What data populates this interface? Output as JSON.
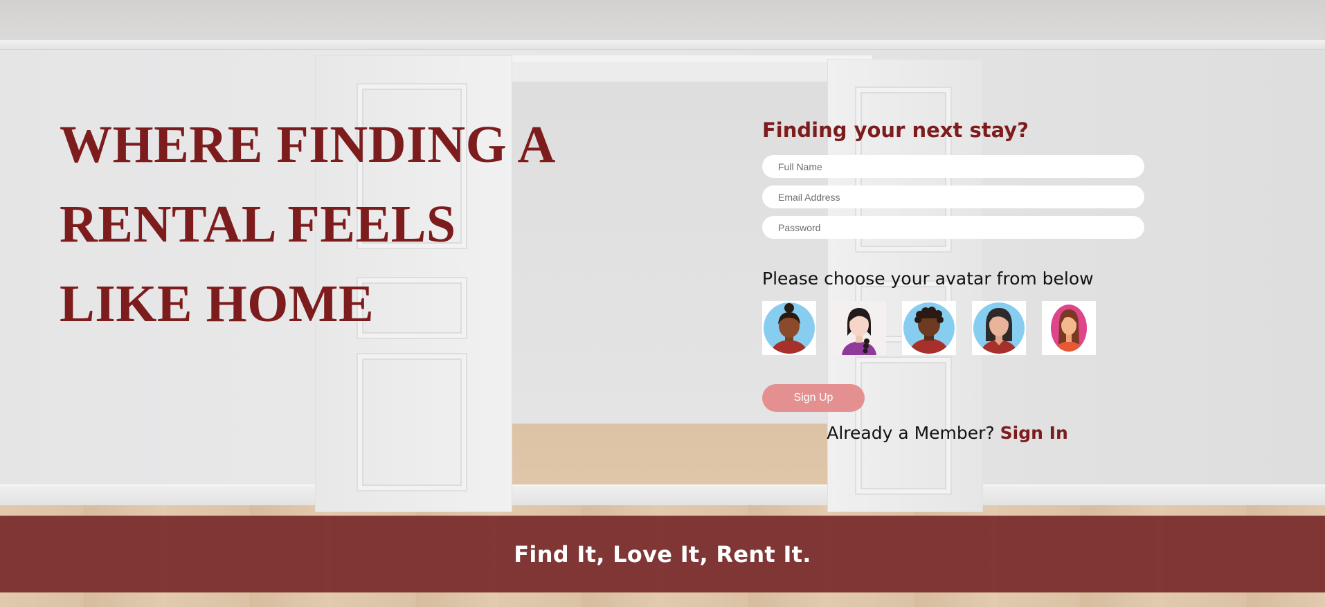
{
  "headline": {
    "lines": [
      "WHERE FINDING A",
      "RENTAL FEELS",
      "LIKE HOME"
    ]
  },
  "form": {
    "title": "Finding your next stay?",
    "full_name_placeholder": "Full Name",
    "email_placeholder": "Email Address",
    "password_placeholder": "Password",
    "avatar_heading": "Please choose your avatar from below",
    "avatars": [
      {
        "icon": "avatar-woman-bun-icon",
        "bg": "#87cdf0",
        "skin": "#8b4a2b",
        "hair": "#2a1a14",
        "shirt": "#a8302a"
      },
      {
        "icon": "avatar-woman-braid-icon",
        "bg": "#f3f0ef",
        "skin": "#f6d6c8",
        "hair": "#231a1c",
        "shirt": "#8e3a9a"
      },
      {
        "icon": "avatar-man-curly-icon",
        "bg": "#87cdf0",
        "skin": "#6e3a22",
        "hair": "#2a1a14",
        "shirt": "#a8302a"
      },
      {
        "icon": "avatar-woman-straight-icon",
        "bg": "#87cdf0",
        "skin": "#e8b49a",
        "hair": "#2f2a2a",
        "shirt": "#a8302a"
      },
      {
        "icon": "avatar-woman-long-hair-icon",
        "bg": "#e0448a",
        "skin": "#f6b88e",
        "hair": "#7a3a22",
        "shirt": "#e55a35"
      }
    ],
    "signup_label": "Sign Up",
    "member_prompt": "Already a Member?",
    "signin_label": "Sign In"
  },
  "banner": {
    "tagline": "Find It, Love It, Rent It."
  },
  "colors": {
    "brand": "#7d1c1d",
    "banner_bg": "#7a2e2e",
    "signup_bg": "#e49091"
  }
}
